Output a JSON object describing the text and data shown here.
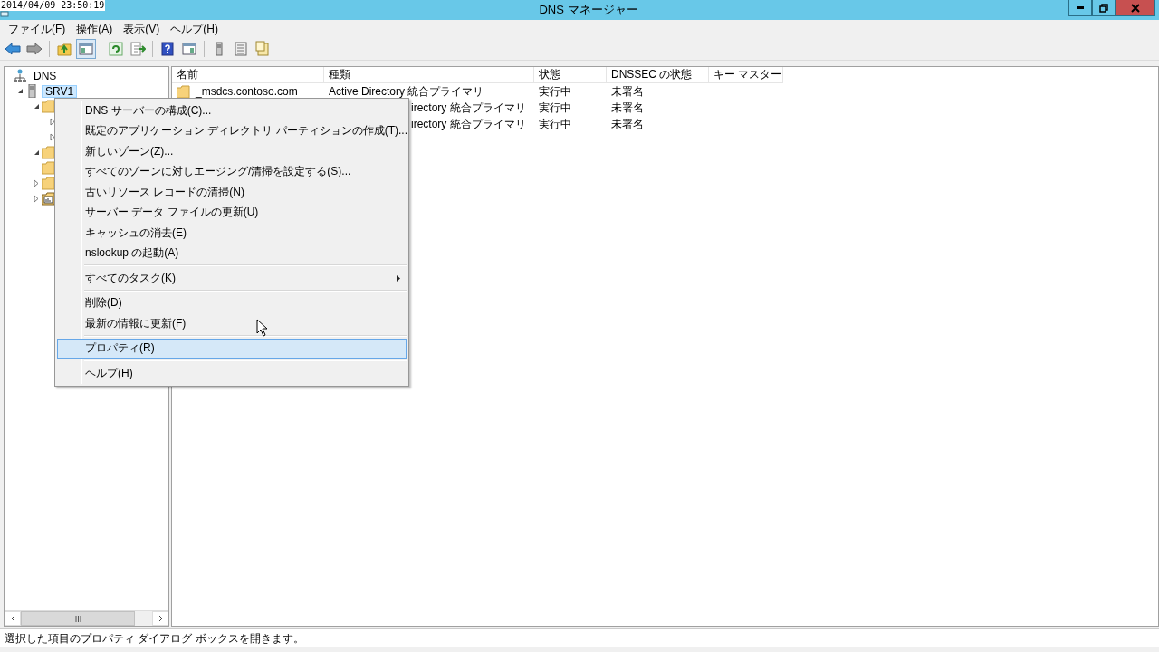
{
  "clock": "2014/04/09 23:50:19",
  "window": {
    "title": "DNS マネージャー"
  },
  "menubar": [
    "ファイル(F)",
    "操作(A)",
    "表示(V)",
    "ヘルプ(H)"
  ],
  "toolbar": [
    {
      "kind": "back",
      "pressed": false
    },
    {
      "kind": "forward",
      "pressed": false
    },
    {
      "kind": "sep"
    },
    {
      "kind": "up",
      "pressed": false
    },
    {
      "kind": "tree",
      "pressed": true
    },
    {
      "kind": "sep"
    },
    {
      "kind": "refresh",
      "pressed": false
    },
    {
      "kind": "export",
      "pressed": false
    },
    {
      "kind": "sep"
    },
    {
      "kind": "help",
      "pressed": false
    },
    {
      "kind": "pane",
      "pressed": false
    },
    {
      "kind": "sep"
    },
    {
      "kind": "server",
      "pressed": false
    },
    {
      "kind": "list",
      "pressed": false
    },
    {
      "kind": "props",
      "pressed": false
    }
  ],
  "tree": [
    {
      "label": "DNS",
      "kind": "network",
      "selected": false,
      "children": [
        {
          "label": "SRV1",
          "kind": "server",
          "selected": true,
          "expanded": true,
          "children": [
            {
              "kind": "folder",
              "expanded": true,
              "children": [
                {
                  "expanded": false
                },
                {
                  "expanded": false
                }
              ]
            },
            {
              "kind": "folder",
              "expanded": true
            },
            {
              "kind": "folder"
            },
            {
              "kind": "folder",
              "expanded": false
            },
            {
              "kind": "log",
              "expanded": false
            }
          ]
        }
      ]
    }
  ],
  "table": {
    "columns": [
      "名前",
      "種類",
      "状態",
      "DNSSEC の状態",
      "キー マスター"
    ],
    "rows": [
      {
        "kind": "full",
        "name": "_msdcs.contoso.com",
        "type": "Active Directory 統合プライマリ",
        "status": "実行中",
        "dnssec": "未署名"
      },
      {
        "kind": "cut",
        "type": "irectory 統合プライマリ",
        "status": "実行中",
        "dnssec": "未署名"
      },
      {
        "kind": "cut",
        "type": "irectory 統合プライマリ",
        "status": "実行中",
        "dnssec": "未署名"
      }
    ]
  },
  "context_menu": [
    {
      "kind": "item",
      "label": "DNS サーバーの構成(C)...",
      "selected": false
    },
    {
      "kind": "item",
      "label": "既定のアプリケーション ディレクトリ パーティションの作成(T)...",
      "selected": false
    },
    {
      "kind": "item",
      "label": "新しいゾーン(Z)...",
      "selected": false
    },
    {
      "kind": "item",
      "label": "すべてのゾーンに対しエージング/清掃を設定する(S)...",
      "selected": false
    },
    {
      "kind": "item",
      "label": "古いリソース レコードの清掃(N)",
      "selected": false
    },
    {
      "kind": "item",
      "label": "サーバー データ ファイルの更新(U)",
      "selected": false
    },
    {
      "kind": "item",
      "label": "キャッシュの消去(E)",
      "selected": false
    },
    {
      "kind": "item",
      "label": "nslookup の起動(A)",
      "selected": false
    },
    {
      "kind": "separator"
    },
    {
      "kind": "submenu",
      "label": "すべてのタスク(K)",
      "selected": false
    },
    {
      "kind": "separator"
    },
    {
      "kind": "item",
      "label": "削除(D)",
      "selected": false
    },
    {
      "kind": "item",
      "label": "最新の情報に更新(F)",
      "selected": false
    },
    {
      "kind": "separator"
    },
    {
      "kind": "item",
      "label": "プロパティ(R)",
      "selected": true
    },
    {
      "kind": "separator"
    },
    {
      "kind": "item",
      "label": "ヘルプ(H)",
      "selected": false
    }
  ],
  "status_bar": "選択した項目のプロパティ ダイアログ ボックスを開きます。"
}
